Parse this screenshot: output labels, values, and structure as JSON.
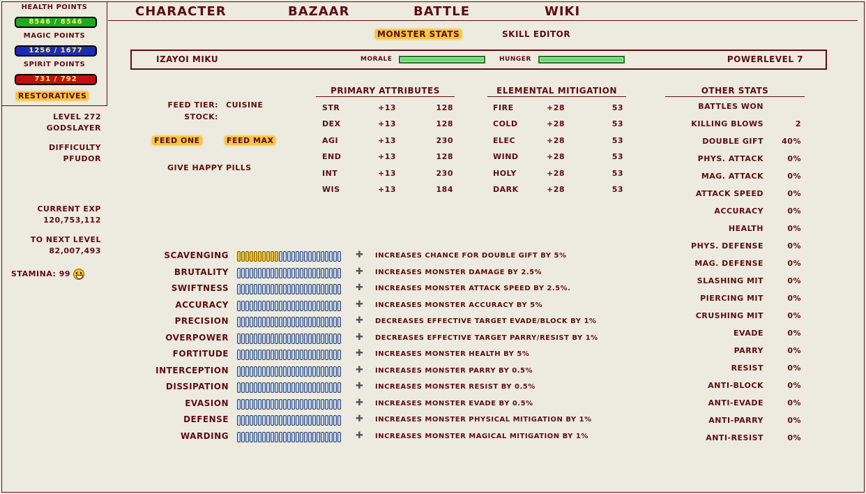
{
  "left": {
    "health": {
      "label": "Health Points",
      "value": "8546 / 8546"
    },
    "magic": {
      "label": "Magic Points",
      "value": "1256 / 1677"
    },
    "spirit": {
      "label": "Spirit Points",
      "value": "731 / 792"
    },
    "restoratives": "Restoratives",
    "level": "Level 272",
    "title": "Godslayer",
    "difficulty_label": "Difficulty",
    "difficulty": "Pfudor",
    "exp_label": "Current EXP",
    "exp": "120,753,112",
    "next_label": "To Next Level",
    "next": "82,007,493",
    "stamina": "Stamina: 99"
  },
  "nav": [
    "Character",
    "Bazaar",
    "Battle",
    "Wiki"
  ],
  "subnav": {
    "active": "Monster Stats",
    "other": "Skill Editor"
  },
  "status": {
    "monster_name": "Izayoi Miku",
    "morale_label": "Morale",
    "hunger_label": "Hunger",
    "morale_fill": 1.0,
    "hunger_fill": 1.0,
    "powerlevel": "Powerlevel 7",
    "colors": {
      "gauge": "#6FD86F"
    }
  },
  "feed": {
    "tier_label": "Feed Tier:",
    "tier": "Cuisine",
    "stock_label": "Stock:",
    "feed_one": "Feed One",
    "feed_max": "Feed Max",
    "happy_pills": "Give Happy Pills"
  },
  "primary": {
    "header": "Primary Attributes",
    "rows": [
      {
        "name": "STR",
        "bonus": "+13",
        "value": "128"
      },
      {
        "name": "DEX",
        "bonus": "+13",
        "value": "128"
      },
      {
        "name": "AGI",
        "bonus": "+13",
        "value": "230"
      },
      {
        "name": "END",
        "bonus": "+13",
        "value": "128"
      },
      {
        "name": "INT",
        "bonus": "+13",
        "value": "230"
      },
      {
        "name": "WIS",
        "bonus": "+13",
        "value": "184"
      }
    ]
  },
  "elemental": {
    "header": "Elemental Mitigation",
    "rows": [
      {
        "name": "FIRE",
        "bonus": "+28",
        "value": "53"
      },
      {
        "name": "COLD",
        "bonus": "+28",
        "value": "53"
      },
      {
        "name": "ELEC",
        "bonus": "+28",
        "value": "53"
      },
      {
        "name": "WIND",
        "bonus": "+28",
        "value": "53"
      },
      {
        "name": "HOLY",
        "bonus": "+28",
        "value": "53"
      },
      {
        "name": "DARK",
        "bonus": "+28",
        "value": "53"
      }
    ]
  },
  "other": {
    "header": "Other Stats",
    "rows": [
      {
        "name": "Battles Won",
        "value": ""
      },
      {
        "name": "Killing Blows",
        "value": "2"
      },
      {
        "name": "Double Gift",
        "value": "40%"
      },
      {
        "name": "Phys. Attack",
        "value": "0%"
      },
      {
        "name": "Mag. Attack",
        "value": "0%"
      },
      {
        "name": "Attack Speed",
        "value": "0%"
      },
      {
        "name": "Accuracy",
        "value": "0%"
      },
      {
        "name": "Health",
        "value": "0%"
      },
      {
        "name": "Phys. Defense",
        "value": "0%"
      },
      {
        "name": "Mag. Defense",
        "value": "0%"
      },
      {
        "name": "Slashing Mit",
        "value": "0%"
      },
      {
        "name": "Piercing Mit",
        "value": "0%"
      },
      {
        "name": "Crushing Mit",
        "value": "0%"
      },
      {
        "name": "Evade",
        "value": "0%"
      },
      {
        "name": "Parry",
        "value": "0%"
      },
      {
        "name": "Resist",
        "value": "0%"
      },
      {
        "name": "Anti-Block",
        "value": "0%"
      },
      {
        "name": "Anti-Evade",
        "value": "0%"
      },
      {
        "name": "Anti-Parry",
        "value": "0%"
      },
      {
        "name": "Anti-Resist",
        "value": "0%"
      }
    ]
  },
  "skills": {
    "max_pips": 25,
    "rows": [
      {
        "name": "Scavenging",
        "level": 10,
        "desc": "Increases chance for double gift by 5%"
      },
      {
        "name": "Brutality",
        "level": 0,
        "desc": "Increases monster damage by 2.5%"
      },
      {
        "name": "Swiftness",
        "level": 0,
        "desc": "Increases monster attack speed by 2.5%."
      },
      {
        "name": "Accuracy",
        "level": 0,
        "desc": "Increases monster accuracy by 5%"
      },
      {
        "name": "Precision",
        "level": 0,
        "desc": "Decreases effective target evade/block by 1%"
      },
      {
        "name": "Overpower",
        "level": 0,
        "desc": "Decreases effective target parry/resist by 1%"
      },
      {
        "name": "Fortitude",
        "level": 0,
        "desc": "Increases monster health by 5%"
      },
      {
        "name": "Interception",
        "level": 0,
        "desc": "Increases monster parry by 0.5%"
      },
      {
        "name": "Dissipation",
        "level": 0,
        "desc": "Increases monster resist by 0.5%"
      },
      {
        "name": "Evasion",
        "level": 0,
        "desc": "Increases monster evade by 0.5%"
      },
      {
        "name": "Defense",
        "level": 0,
        "desc": "Increases monster physical mitigation by 1%"
      },
      {
        "name": "Warding",
        "level": 0,
        "desc": "Increases monster magical mitigation by 1%"
      }
    ]
  }
}
